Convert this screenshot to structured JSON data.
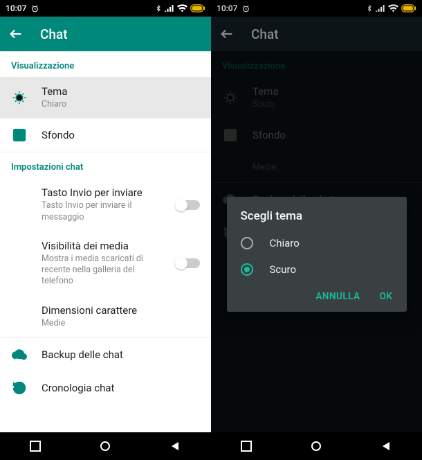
{
  "status": {
    "time": "10:07"
  },
  "appbar": {
    "title": "Chat"
  },
  "sections": {
    "visualization": "Visualizzazione",
    "chat_settings": "Impostazioni chat"
  },
  "rows": {
    "theme": {
      "title": "Tema",
      "value_light": "Chiaro",
      "value_dark": "Scuro"
    },
    "wallpaper": {
      "title": "Sfondo"
    },
    "enter_send": {
      "title": "Tasto Invio per inviare",
      "sub": "Tasto Invio per inviare il messaggio"
    },
    "media_vis": {
      "title": "Visibilità dei media",
      "sub": "Mostra i media scaricati di recente nella galleria del telefono"
    },
    "font_size": {
      "title": "Dimensioni carattere",
      "sub": "Medie"
    },
    "backup": {
      "title": "Backup delle chat"
    },
    "history": {
      "title": "Cronologia chat"
    }
  },
  "dialog": {
    "title": "Scegli tema",
    "option_light": "Chiaro",
    "option_dark": "Scuro",
    "cancel": "ANNULLA",
    "ok": "OK"
  }
}
